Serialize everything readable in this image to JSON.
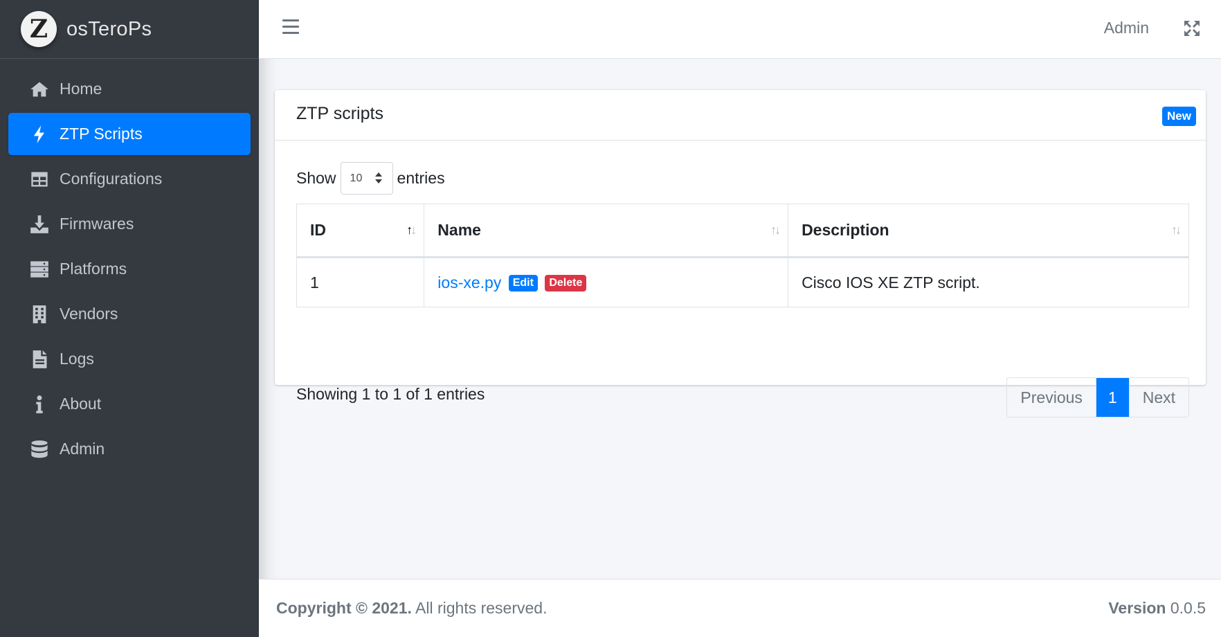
{
  "brand": {
    "logo_letter": "Z",
    "name": "osTeroPs"
  },
  "sidebar": {
    "items": [
      {
        "label": "Home",
        "icon": "home-icon",
        "active": false
      },
      {
        "label": "ZTP Scripts",
        "icon": "bolt-icon",
        "active": true
      },
      {
        "label": "Configurations",
        "icon": "table-icon",
        "active": false
      },
      {
        "label": "Firmwares",
        "icon": "download-icon",
        "active": false
      },
      {
        "label": "Platforms",
        "icon": "server-icon",
        "active": false
      },
      {
        "label": "Vendors",
        "icon": "building-icon",
        "active": false
      },
      {
        "label": "Logs",
        "icon": "file-icon",
        "active": false
      },
      {
        "label": "About",
        "icon": "info-icon",
        "active": false
      },
      {
        "label": "Admin",
        "icon": "database-icon",
        "active": false
      }
    ]
  },
  "topbar": {
    "user": "Admin"
  },
  "card": {
    "title": "ZTP scripts",
    "new_label": "New",
    "show_label": "Show",
    "entries_label": "entries",
    "page_length": "10",
    "columns": [
      "ID",
      "Name",
      "Description"
    ],
    "rows": [
      {
        "id": "1",
        "name": "ios-xe.py",
        "edit_label": "Edit",
        "delete_label": "Delete",
        "description": "Cisco IOS XE ZTP script."
      }
    ],
    "info": "Showing 1 to 1 of 1 entries",
    "pagination": {
      "previous": "Previous",
      "current": "1",
      "next": "Next"
    }
  },
  "footer": {
    "copyright_bold": "Copyright © 2021.",
    "copyright_rest": " All rights reserved.",
    "version_label": "Version",
    "version_value": " 0.0.5"
  },
  "colors": {
    "primary": "#007bff",
    "danger": "#dc3545",
    "sidebar": "#343a40"
  }
}
